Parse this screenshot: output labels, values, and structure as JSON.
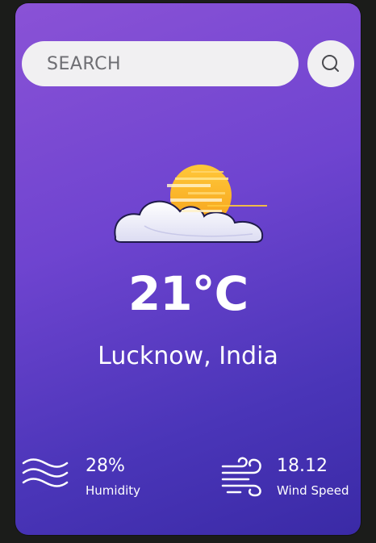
{
  "search": {
    "placeholder": "SEARCH",
    "button_icon": "search-icon"
  },
  "weather": {
    "icon": "partly-cloudy-icon",
    "temperature": "21°C",
    "location": "Lucknow, India"
  },
  "stats": {
    "humidity": {
      "icon": "humidity-waves-icon",
      "value": "28%",
      "label": "Humidity"
    },
    "wind": {
      "icon": "wind-icon",
      "value": "18.12",
      "label": "Wind Speed"
    }
  },
  "colors": {
    "card_gradient_start": "#8a52d6",
    "card_gradient_end": "#3a2aa6",
    "search_bg": "#f1f0f2",
    "text": "#ffffff"
  }
}
